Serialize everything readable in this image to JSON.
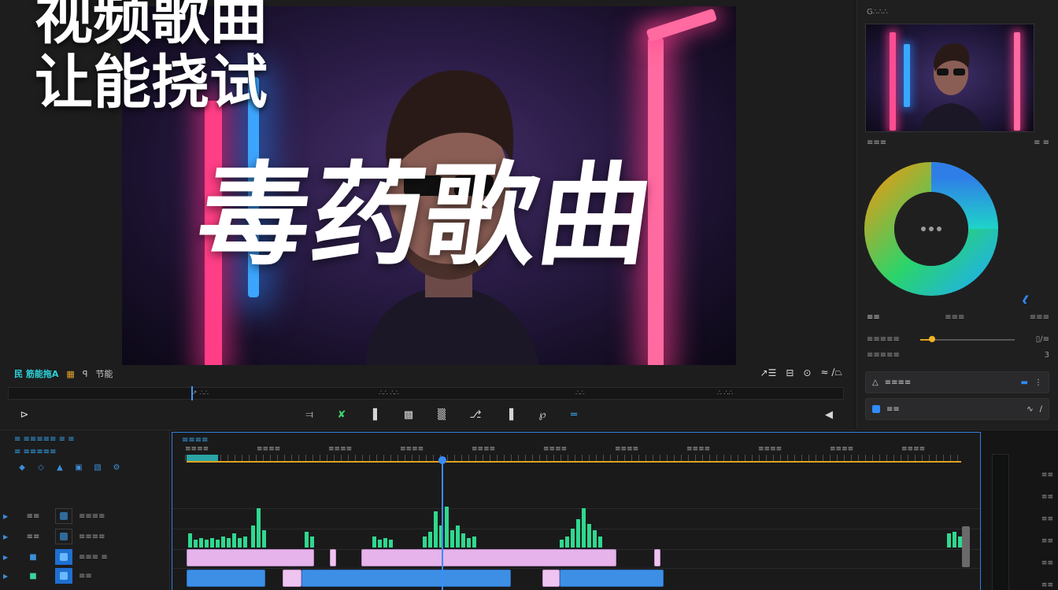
{
  "overlay_title": [
    "视频歌曲",
    "让能挠试"
  ],
  "video_title": "毒药歌曲",
  "monitor": {
    "timecode": "民 筋能拖A",
    "fit_icon": "fit-icon",
    "label1": "ꟼ",
    "label2": "节能",
    "right_controls": [
      "↗☰",
      "⊟",
      "⊙",
      "≈ ∕⏢"
    ],
    "ruler_labels": [
      "↗ ∴∴",
      "∴∴ ∴∴",
      "∴∴",
      "∴ ∴∴"
    ],
    "transport": [
      "⊳",
      "⫤",
      "✘",
      "▌",
      "▩",
      "▒",
      "⎇",
      "▐",
      "℘",
      "═"
    ],
    "transport_icons": [
      "play-icon",
      "mark-in-icon",
      "snap-icon",
      "stop-icon",
      "record-icon",
      "insert-icon",
      "lift-icon",
      "extract-icon",
      "export-frame-icon",
      "settings-icon"
    ]
  },
  "right_panel": {
    "header": "G∴∴∴",
    "section1_label": "≡≡≡",
    "section1_right": "≡ ≡",
    "tabs": [
      "≡≡",
      "≡≡≡",
      "≡≡≡"
    ],
    "row1_label": "≡≡≡≡≡",
    "row1_value": "▯∕≡",
    "row2_label": "≡≡≡≡≡",
    "row2_value": "3",
    "slider_fraction": 0.12,
    "card1_label": "≡≡≡≡",
    "card2_label": "≡≡",
    "wheel_colors": [
      "#d4a11c",
      "#2bd46a",
      "#1fb4e0",
      "#2f7ee8"
    ]
  },
  "timeline": {
    "sequence_name": "≡≡≡≡",
    "header_title": "≡ ≡≡≡≡≡  ≡  ≡",
    "header_sub": "≡ ≡≡≡≡≡",
    "ruler_labels": [
      "≡≡≡≡",
      "≡≡≡≡",
      "≡≡≡≡",
      "≡≡≡≡",
      "≡≡≡≡",
      "≡≡≡≡",
      "≡≡≡≡",
      "≡≡≡≡",
      "≡≡≡≡",
      "≡≡≡≡",
      "≡≡≡≡"
    ],
    "tracks": [
      {
        "name": "≡≡",
        "label": "≡≡≡≡",
        "type": "audio"
      },
      {
        "name": "≡≡",
        "label": "≡≡≡≡",
        "type": "audio"
      },
      {
        "name": "",
        "label": "≡≡≡  ≡",
        "type": "video"
      },
      {
        "name": "",
        "label": "≡≡",
        "type": "video"
      }
    ],
    "meter_labels": [
      "≡≡",
      "≡≡",
      "≡≡",
      "≡≡",
      "≡≡",
      "≡≡"
    ],
    "playhead_fraction": 0.333
  }
}
